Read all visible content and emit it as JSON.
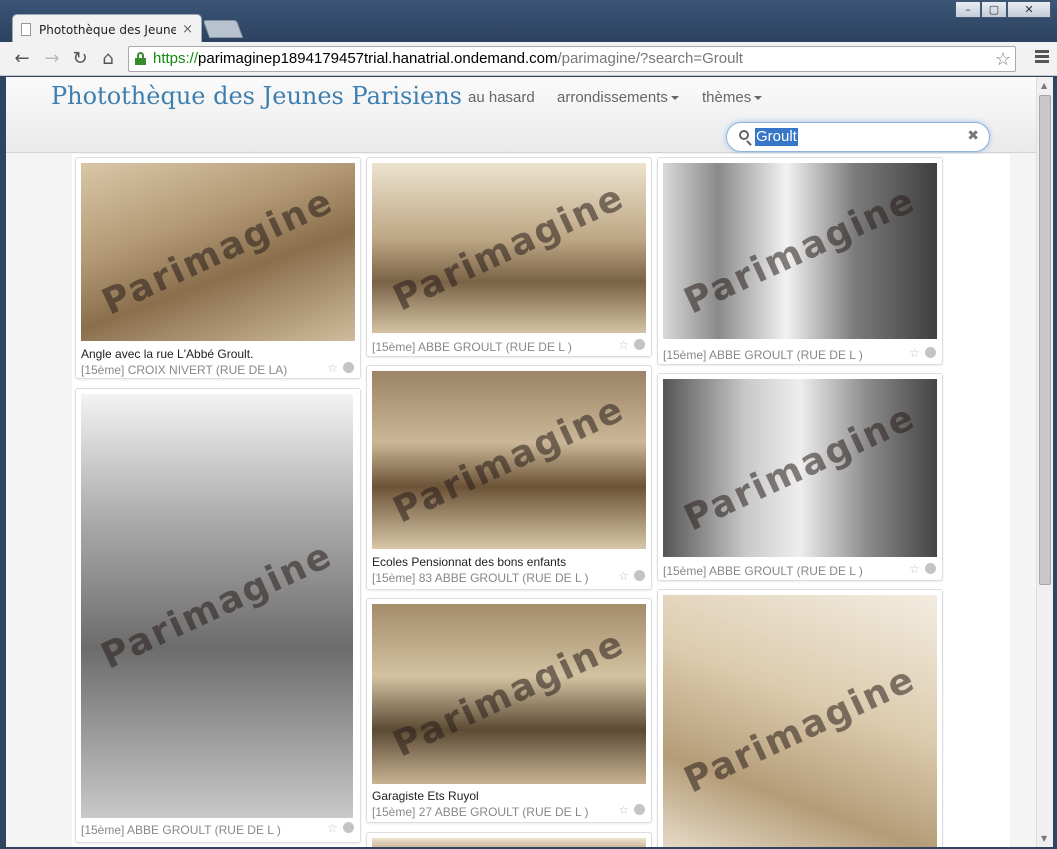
{
  "browser": {
    "tab_title": "Photothèque des Jeunes P",
    "tab_close": "×",
    "url_https": "https://",
    "url_host": "parimaginep1894179457trial.hanatrial.ondemand.com",
    "url_path": "/parimagine/?search=Groult",
    "window_buttons": [
      "–",
      "▢",
      "✕"
    ]
  },
  "site": {
    "brand": "Photothèque des Jeunes Parisiens",
    "nav": [
      "au hasard",
      "arrondissements",
      "thèmes"
    ],
    "search_value": "Groult",
    "search_clear": "✖"
  },
  "watermark": "Parimagine",
  "cards": [
    {
      "caption": "Angle avec la rue L'Abbé Groult.",
      "meta": "[15ème] CROIX NIVERT (RUE DE LA)"
    },
    {
      "caption": "",
      "meta": "[15ème] ABBE GROULT (RUE DE L )"
    },
    {
      "caption": "",
      "meta": "[15ème] ABBE GROULT (RUE DE L )"
    },
    {
      "caption": "",
      "meta": "[15ème] ABBE GROULT (RUE DE L )"
    },
    {
      "caption": "Ecoles Pensionnat des bons enfants",
      "meta": "[15ème] 83 ABBE GROULT (RUE DE L )"
    },
    {
      "caption": "",
      "meta": "[15ème] ABBE GROULT (RUE DE L )"
    },
    {
      "caption": "Garagiste Ets Ruyol",
      "meta": "[15ème] 27 ABBE GROULT (RUE DE L )"
    },
    {
      "caption": "",
      "meta": ""
    }
  ],
  "icons": {
    "star": "☆"
  }
}
